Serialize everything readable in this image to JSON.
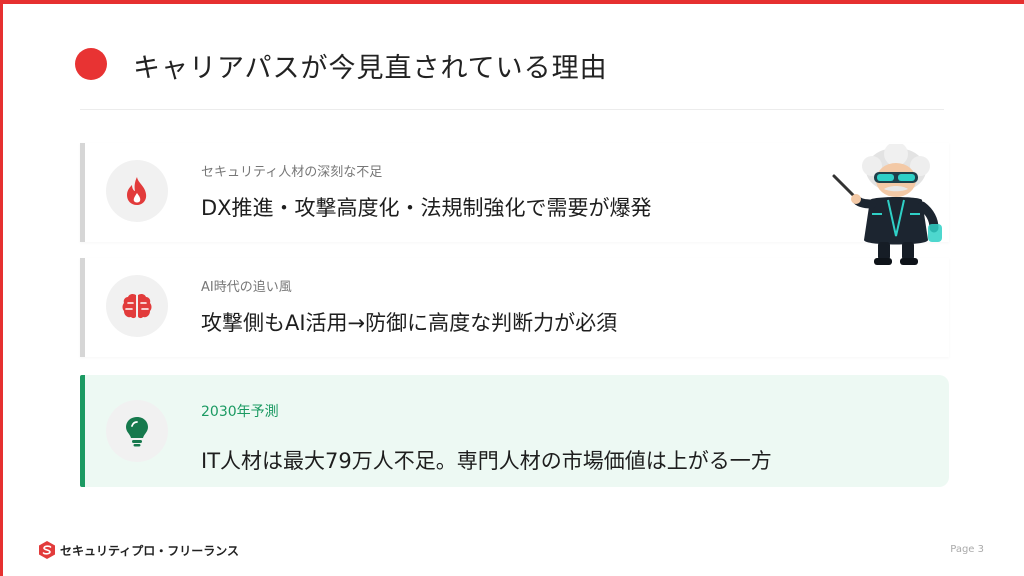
{
  "slide": {
    "title": "キャリアパスが今見直されている理由",
    "accent_color": "#e63030",
    "highlight_color": "#1b9a62"
  },
  "cards": [
    {
      "kicker": "セキュリティ人材の深刻な不足",
      "headline": "DX推進・攻撃高度化・法規制強化で需要が爆発",
      "icon": "fire-icon"
    },
    {
      "kicker": "AI時代の追い風",
      "headline": "攻撃側もAI活用→防御に高度な判断力が必須",
      "icon": "brain-icon"
    },
    {
      "kicker": "2030年予測",
      "headline": "IT人材は最大79万人不足。専門人材の市場価値は上がる一方",
      "icon": "lightbulb-icon"
    }
  ],
  "footer": {
    "brand": "セキュリティプロ・フリーランス",
    "page": "Page 3"
  }
}
